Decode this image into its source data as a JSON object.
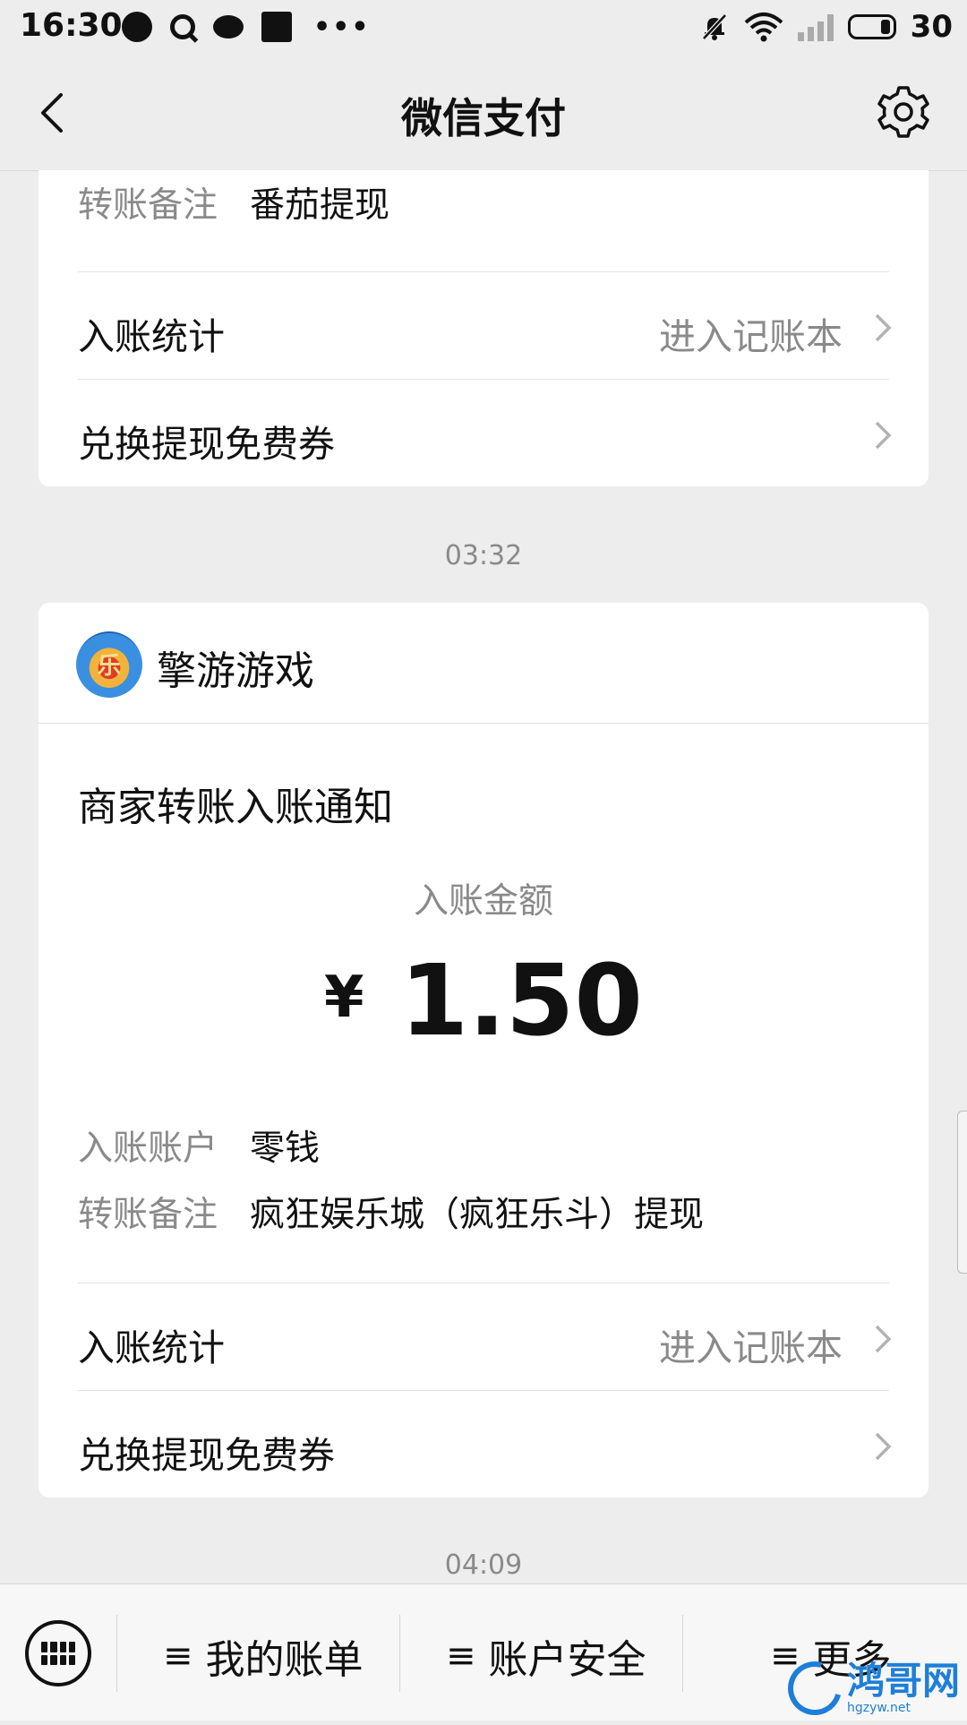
{
  "status_bar": {
    "time": "16:30",
    "battery": "30"
  },
  "nav": {
    "title": "微信支付"
  },
  "card1": {
    "remark_label": "转账备注",
    "remark_value": "番茄提现",
    "stats_label": "入账统计",
    "stats_link": "进入记账本",
    "coupon_label": "兑换提现免费券"
  },
  "timestamp1": "03:32",
  "card2": {
    "merchant_name": "擎游游戏",
    "merchant_avatar_text": "乐",
    "notice_title": "商家转账入账通知",
    "amount_label": "入账金额",
    "currency": "¥",
    "amount": "1.50",
    "account_label": "入账账户",
    "account_value": "零钱",
    "remark_label": "转账备注",
    "remark_value": "疯狂娱乐城（疯狂乐斗）提现",
    "stats_label": "入账统计",
    "stats_link": "进入记账本",
    "coupon_label": "兑换提现免费券"
  },
  "timestamp2": "04:09",
  "bottom_menu": {
    "items": [
      "我的账单",
      "账户安全",
      "更多"
    ]
  },
  "watermark": {
    "main": "鸿哥网",
    "sub": "hgzyw.net"
  }
}
